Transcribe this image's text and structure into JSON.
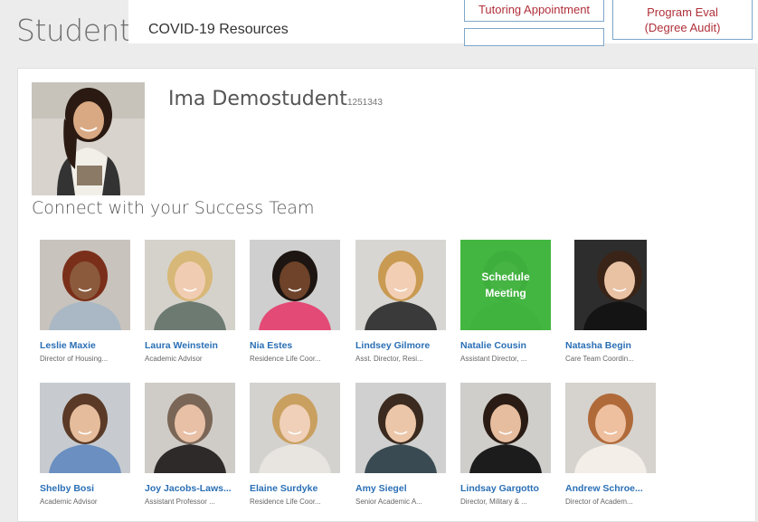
{
  "header": {
    "page_title": "Student",
    "covid_link": "COVID-19 Resources",
    "tutoring_button": "Tutoring Appointment",
    "program_eval_line1": "Program Eval",
    "program_eval_line2": "(Degree Audit)"
  },
  "student": {
    "name": "Ima Demostudent",
    "id": "1251343"
  },
  "success_team": {
    "heading": "Connect with your Success Team",
    "schedule_label_1": "Schedule",
    "schedule_label_2": "Meeting",
    "members": [
      {
        "name": "Leslie Maxie",
        "title": "Director of Housing...",
        "bg": "#c9c3bd",
        "skin": "#8b5a3c",
        "hair": "#7a2f1a",
        "shirt": "#a9b8c4"
      },
      {
        "name": "Laura Weinstein",
        "title": "Academic Advisor",
        "bg": "#d5d2cc",
        "skin": "#f0cdb2",
        "hair": "#d8b878",
        "shirt": "#6c7a72"
      },
      {
        "name": "Nia Estes",
        "title": "Residence Life Coor...",
        "bg": "#cfcfcf",
        "skin": "#6e4329",
        "hair": "#1d1511",
        "shirt": "#e34a76"
      },
      {
        "name": "Lindsey Gilmore",
        "title": "Asst. Director, Resi...",
        "bg": "#d8d6d2",
        "skin": "#f2cfb4",
        "hair": "#c99a52",
        "shirt": "#3a3a3a"
      },
      {
        "name": "Natalie Cousin",
        "title": "Assistant Director, ...",
        "bg": "#6fbf5d",
        "skin": "#78b56a",
        "hair": "#4e8f44",
        "shirt": "#5aa64b",
        "schedule": true
      },
      {
        "name": "Natasha Begin",
        "title": "Care Team Coordin...",
        "bg": "#2d2d2d",
        "skin": "#e9c2a4",
        "hair": "#3a2418",
        "shirt": "#141414"
      },
      {
        "name": "Shelby Bosi",
        "title": "Academic Advisor",
        "bg": "#c7cbd0",
        "skin": "#e6bd9c",
        "hair": "#5a3a26",
        "shirt": "#6a8fc0"
      },
      {
        "name": "Joy Jacobs-Laws...",
        "title": "Assistant Professor ...",
        "bg": "#cfccc8",
        "skin": "#e8c0a6",
        "hair": "#7a6656",
        "shirt": "#2f2a2a"
      },
      {
        "name": "Elaine Surdyke",
        "title": "Residence Life Coor...",
        "bg": "#d4d2cf",
        "skin": "#f0d0b8",
        "hair": "#c9a060",
        "shirt": "#e8e4e0"
      },
      {
        "name": "Amy Siegel",
        "title": "Senior Academic A...",
        "bg": "#cfd0cf",
        "skin": "#ecc6a8",
        "hair": "#3b2a1f",
        "shirt": "#3a4a52"
      },
      {
        "name": "Lindsay Gargotto",
        "title": "Director, Military & ...",
        "bg": "#cfcecb",
        "skin": "#e6bd9e",
        "hair": "#2a1c14",
        "shirt": "#1c1c1c"
      },
      {
        "name": "Andrew Schroe...",
        "title": "Director of Academ...",
        "bg": "#d6d3cf",
        "skin": "#eec0a0",
        "hair": "#b06a3a",
        "shirt": "#f3eee8"
      }
    ]
  },
  "student_photo_colors": {
    "bg": "#d8d4cd",
    "skin": "#d9a983",
    "hair": "#2a1a12",
    "shirt": "#f2efe9",
    "jacket": "#333333"
  }
}
